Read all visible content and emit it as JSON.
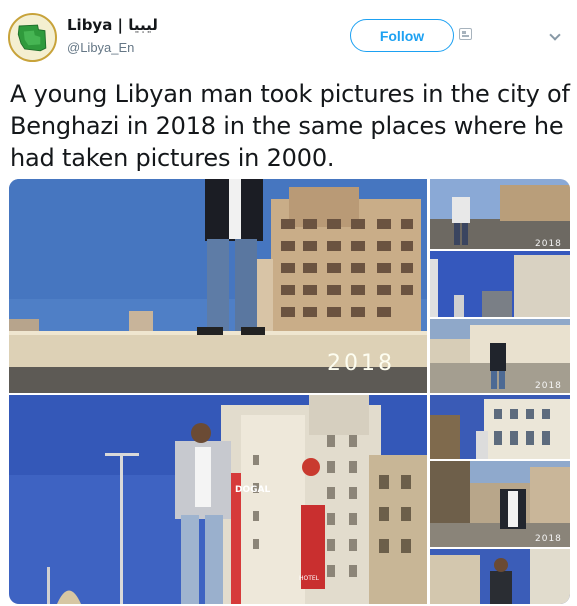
{
  "account": {
    "display_name": "Libya | ليبيا",
    "handle": "@Libya_En",
    "avatar_icon": "libya-map-icon"
  },
  "actions": {
    "follow_label": "Follow",
    "follow_color": "#1da1f2"
  },
  "tweet": {
    "text": "A young Libyan man took pictures in the city of Benghazi in 2018 in the same places where he had taken pictures in 2000."
  },
  "media": {
    "year_labels": {
      "main_top": "2018",
      "side_1": "2018",
      "side_3": "2018",
      "side_5": "2018"
    },
    "hotel_sign": "DOGAL",
    "hotel_sign_sub": "HOTEL"
  }
}
